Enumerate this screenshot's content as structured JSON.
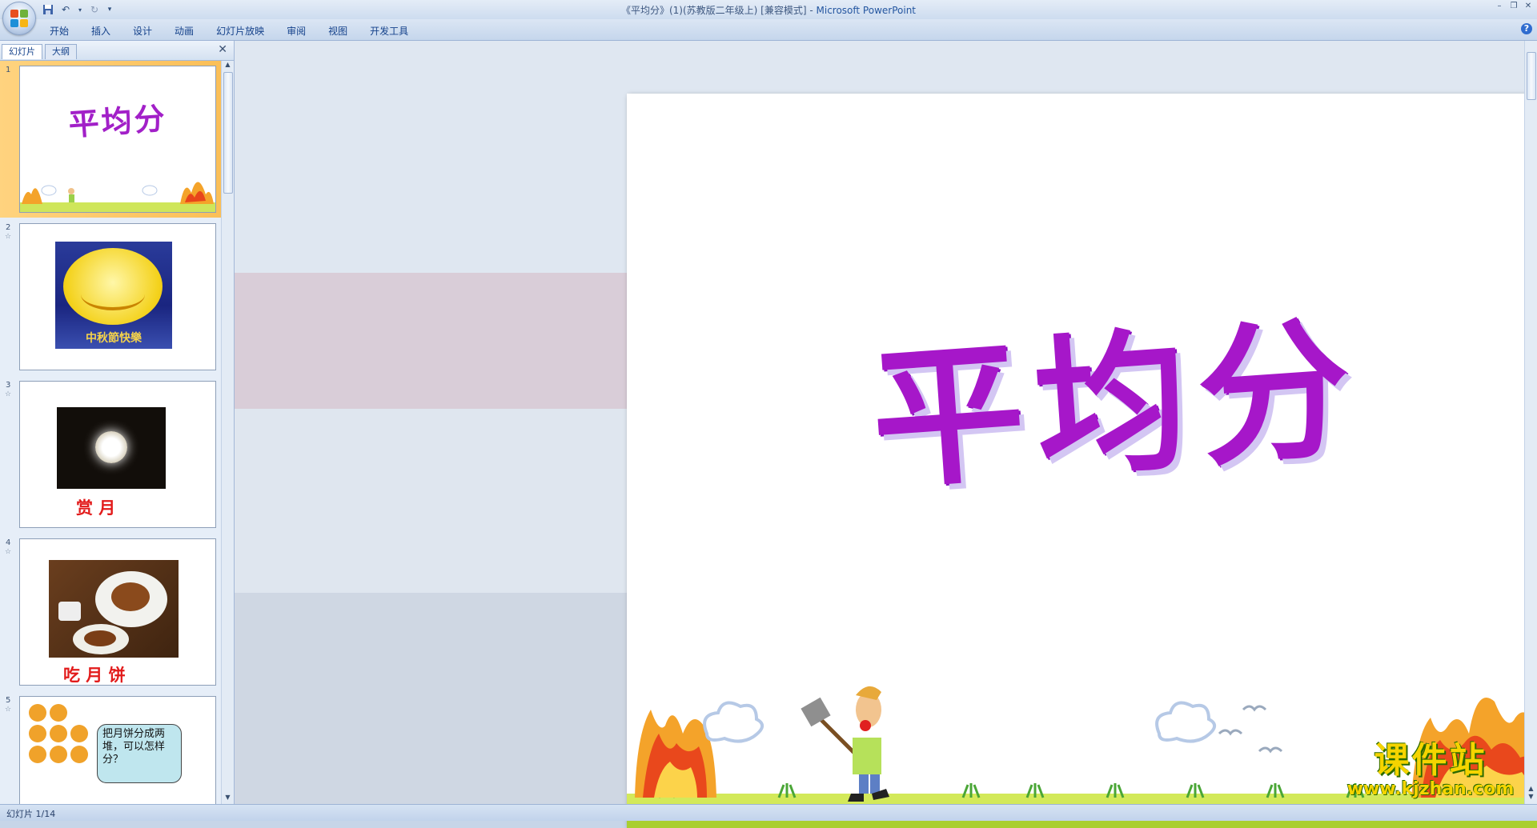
{
  "window": {
    "title_doc": "《平均分》(1)(苏教版二年级上) [兼容模式]",
    "title_sep": " - ",
    "title_app": "Microsoft PowerPoint"
  },
  "ribbon": {
    "tabs": [
      "开始",
      "插入",
      "设计",
      "动画",
      "幻灯片放映",
      "审阅",
      "视图",
      "开发工具"
    ]
  },
  "panel": {
    "tab_slides": "幻灯片",
    "tab_outline": "大纲"
  },
  "thumbnails": [
    {
      "num": "1",
      "title": "平均分"
    },
    {
      "num": "2",
      "banner": "中秋節快樂"
    },
    {
      "num": "3",
      "caption": "赏   月"
    },
    {
      "num": "4",
      "caption": "吃 月 饼"
    },
    {
      "num": "5",
      "bubble": "把月饼分成两堆，可以怎样分？"
    }
  ],
  "slide": {
    "title": "平均分"
  },
  "status": {
    "text": "幻灯片 1/14"
  },
  "watermark": {
    "top": "课件站",
    "bottom": "www.kjzhan.com"
  },
  "colors": {
    "title_purple": "#a617c9",
    "selected_thumb": "#fbbf57"
  }
}
